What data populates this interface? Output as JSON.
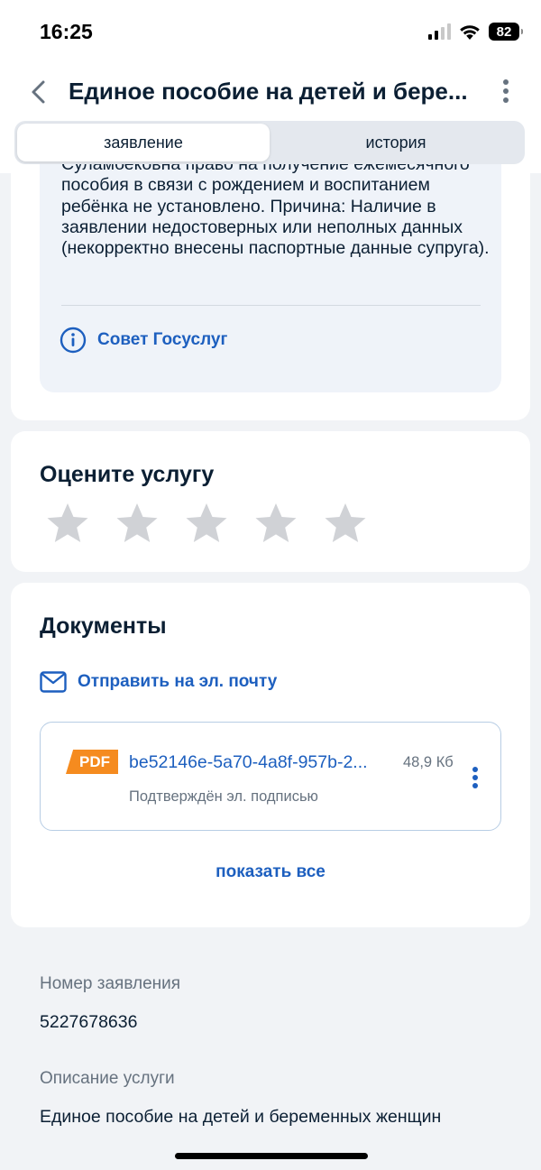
{
  "status_bar": {
    "time": "16:25",
    "battery": "82"
  },
  "header": {
    "title": "Единое пособие на детей и бере...",
    "tabs": [
      {
        "label": "заявление",
        "active": true
      },
      {
        "label": "история",
        "active": false
      }
    ]
  },
  "status_card": {
    "text": "Суламбековна право на получение ежемесячного пособия в связи с рождением и воспитанием ребёнка не установлено. Причина: Наличие в заявлении недостоверных или неполных данных (некорректно внесены паспортные данные супруга).",
    "advice_label": "Совет Госуслуг"
  },
  "rating": {
    "title": "Оцените услугу",
    "star_count": 5
  },
  "documents": {
    "title": "Документы",
    "email_label": "Отправить на эл. почту",
    "file": {
      "badge": "PDF",
      "name": "be52146e-5a70-4a8f-957b-2...",
      "size": "48,9 Кб",
      "signature": "Подтверждён эл. подписью"
    },
    "show_all": "показать все"
  },
  "details": {
    "number_label": "Номер заявления",
    "number_value": "5227678636",
    "service_label": "Описание услуги",
    "service_value": "Единое пособие на детей и беременных женщин"
  },
  "colors": {
    "accent": "#1d5fbf",
    "star": "#d0d2d6",
    "pdf": "#f58b1f",
    "info_bg": "#eff3f9"
  }
}
